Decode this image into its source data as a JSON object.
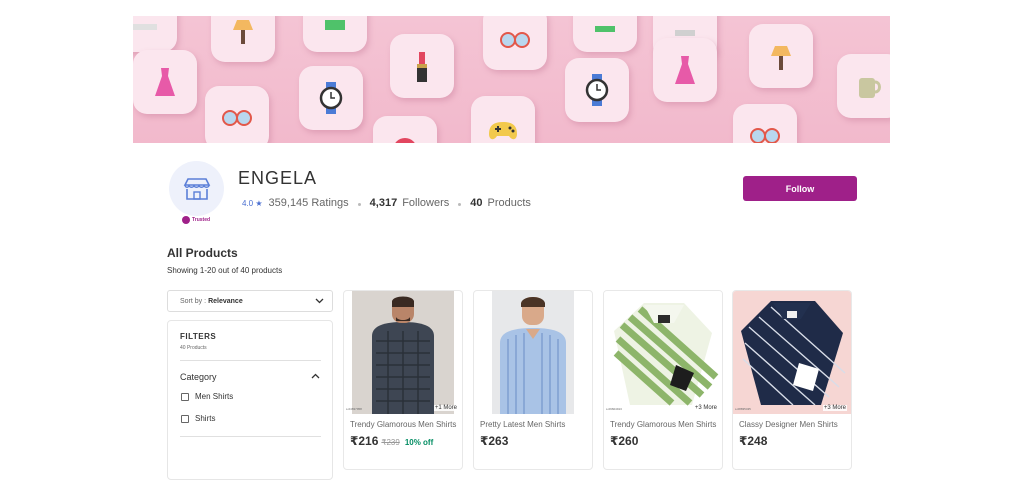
{
  "banner": {
    "icons": [
      "dress-icon",
      "sunglasses-icon",
      "watch-icon",
      "lipstick-icon",
      "lamp-icon",
      "gamepad-icon",
      "mug-icon"
    ]
  },
  "shop": {
    "name": "ENGELA",
    "trusted_label": "Trusted",
    "rating": "4.0",
    "ratings_count": "359,145 Ratings",
    "followers_count": "4,317",
    "followers_label": "Followers",
    "products_count": "40",
    "products_label": "Products",
    "follow_label": "Follow",
    "accent": "#9f2089"
  },
  "listing": {
    "title": "All Products",
    "showing": "Showing 1-20 out of 40 products",
    "sort_prefix": "Sort by :",
    "sort_value": "Relevance"
  },
  "filters": {
    "title": "FILTERS",
    "subtitle": "40 Products",
    "category_label": "Category",
    "options": [
      "Men Shirts",
      "Shirts"
    ]
  },
  "products": [
    {
      "name": "Trendy Glamorous Men Shirts",
      "price": "₹216",
      "mrp": "₹239",
      "discount": "10% off",
      "more": "+1 More",
      "id": "s-04837958"
    },
    {
      "name": "Pretty Latest Men Shirts",
      "price": "₹263",
      "mrp": "",
      "discount": "",
      "more": "",
      "id": ""
    },
    {
      "name": "Trendy Glamorous Men Shirts",
      "price": "₹260",
      "mrp": "",
      "discount": "",
      "more": "+3 More",
      "id": "s-09604913"
    },
    {
      "name": "Classy Designer Men Shirts",
      "price": "₹248",
      "mrp": "",
      "discount": "",
      "more": "+3 More",
      "id": "s-08835435"
    }
  ]
}
